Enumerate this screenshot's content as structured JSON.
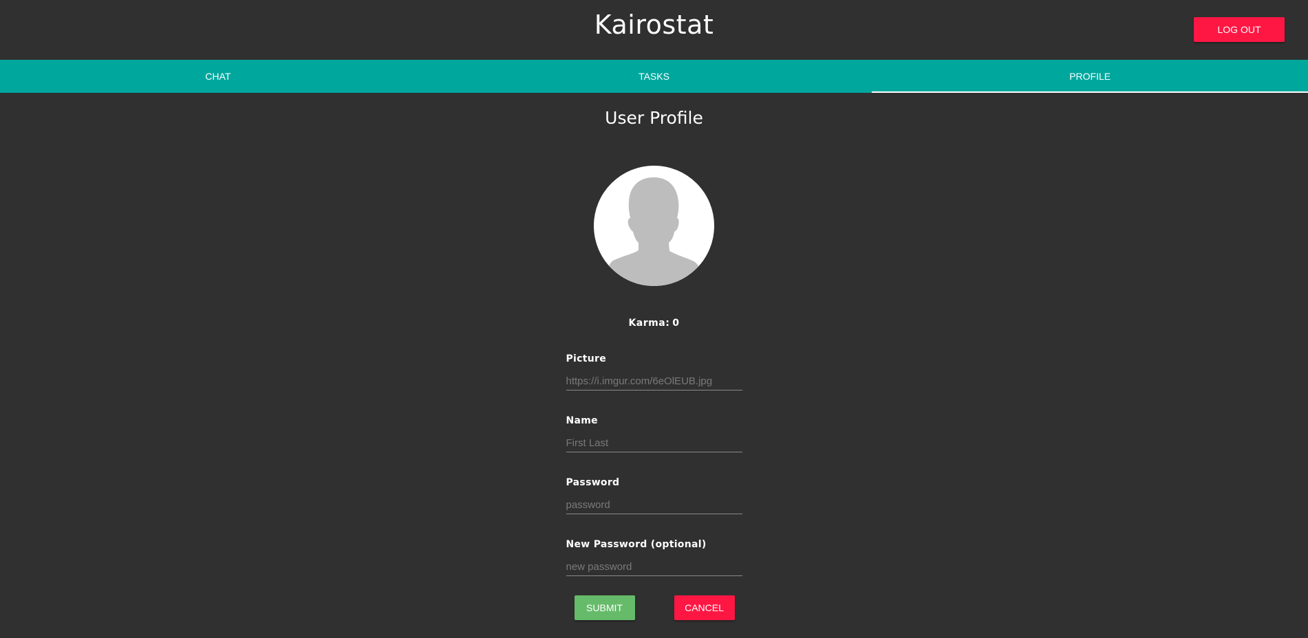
{
  "header": {
    "title": "Kairostat",
    "logout_label": "LOG OUT"
  },
  "tabs": [
    {
      "label": "CHAT",
      "active": false
    },
    {
      "label": "TASKS",
      "active": false
    },
    {
      "label": "PROFILE",
      "active": true
    }
  ],
  "profile": {
    "title": "User Profile",
    "avatar_icon": "user-silhouette-icon",
    "karma_label": "Karma:",
    "karma_value": "0",
    "fields": [
      {
        "label": "Picture",
        "placeholder": "https://i.imgur.com/6eOlEUB.jpg",
        "value": ""
      },
      {
        "label": "Name",
        "placeholder": "First Last",
        "value": ""
      },
      {
        "label": "Password",
        "placeholder": "password",
        "value": ""
      },
      {
        "label": "New Password (optional)",
        "placeholder": "new password",
        "value": ""
      }
    ],
    "submit_label": "SUBMIT",
    "cancel_label": "CANCEL"
  },
  "colors": {
    "background": "#303030",
    "tab_bar": "#00a79d",
    "logout": "#ff1744",
    "submit": "#66bb6a",
    "cancel": "#ff1744"
  }
}
